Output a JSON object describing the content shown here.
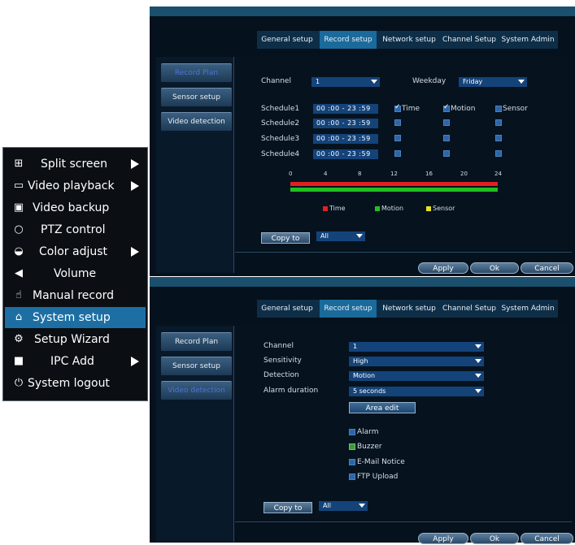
{
  "menu": {
    "items": [
      {
        "label": "Split screen",
        "icon": "grid-icon",
        "arrow": true
      },
      {
        "label": "Video playback",
        "icon": "film-icon",
        "arrow": true
      },
      {
        "label": "Video backup",
        "icon": "save-icon",
        "arrow": false
      },
      {
        "label": "PTZ control",
        "icon": "ptz-icon",
        "arrow": false
      },
      {
        "label": "Color adjust",
        "icon": "palette-icon",
        "arrow": true
      },
      {
        "label": "Volume",
        "icon": "speaker-icon",
        "arrow": false
      },
      {
        "label": "Manual record",
        "icon": "hand-icon",
        "arrow": false
      },
      {
        "label": "System setup",
        "icon": "home-icon",
        "arrow": false
      },
      {
        "label": "Setup Wizard",
        "icon": "gears-icon",
        "arrow": false
      },
      {
        "label": "IPC Add",
        "icon": "camera-icon",
        "arrow": true
      },
      {
        "label": "System logout",
        "icon": "power-icon",
        "arrow": false
      }
    ],
    "selected": "System setup",
    "selected_color": "#1d6fa3"
  },
  "tabs": [
    "General setup",
    "Record setup",
    "Network setup",
    "Channel Setup",
    "System Admin"
  ],
  "active_tab": "Record setup",
  "left_buttons": [
    "Record Plan",
    "Sensor setup",
    "Video detection"
  ],
  "record_plan": {
    "channel_label": "Channel",
    "channel_value": "1",
    "weekday_label": "Weekday",
    "weekday_value": "Friday",
    "schedules": [
      {
        "label": "Schedule1",
        "time": "00 :00 - 23 :59",
        "time_chk": true,
        "motion_chk": true,
        "sensor_chk": false
      },
      {
        "label": "Schedule2",
        "time": "00 :00 - 23 :59",
        "time_chk": false,
        "motion_chk": false,
        "sensor_chk": false
      },
      {
        "label": "Schedule3",
        "time": "00 :00 - 23 :59",
        "time_chk": false,
        "motion_chk": false,
        "sensor_chk": false
      },
      {
        "label": "Schedule4",
        "time": "00 :00 - 23 :59",
        "time_chk": false,
        "motion_chk": false,
        "sensor_chk": false
      }
    ],
    "col_headers": {
      "time": "Time",
      "motion": "Motion",
      "sensor": "Sensor"
    },
    "timeline_ticks": [
      "0",
      "4",
      "8",
      "12",
      "16",
      "20",
      "24"
    ],
    "legend": [
      {
        "label": "Time",
        "color": "#e02020"
      },
      {
        "label": "Motion",
        "color": "#20c020"
      },
      {
        "label": "Sensor",
        "color": "#e8e020"
      }
    ],
    "copy_to": "Copy to",
    "copy_value": "All"
  },
  "footer": {
    "apply": "Apply",
    "ok": "Ok",
    "cancel": "Cancel"
  },
  "video_detection": {
    "fields": [
      {
        "label": "Channel",
        "value": "1"
      },
      {
        "label": "Sensitivity",
        "value": "High"
      },
      {
        "label": "Detection",
        "value": "Motion"
      },
      {
        "label": "Alarm duration",
        "value": "5 seconds"
      }
    ],
    "area_edit": "Area edit",
    "options": [
      {
        "label": "Alarm",
        "checked": false
      },
      {
        "label": "Buzzer",
        "checked": true
      },
      {
        "label": "E-Mail Notice",
        "checked": false
      },
      {
        "label": "FTP Upload",
        "checked": false
      }
    ],
    "copy_to": "Copy to",
    "copy_value": "All"
  }
}
